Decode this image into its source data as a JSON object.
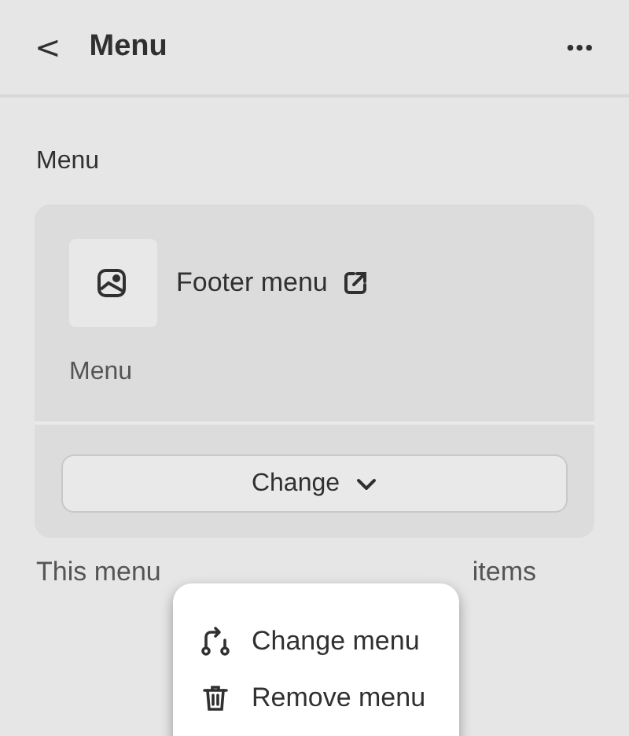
{
  "header": {
    "back": "<",
    "title": "Menu",
    "more": "•••"
  },
  "section": {
    "label": "Menu",
    "card": {
      "name": "Footer menu",
      "subtitle": "Menu",
      "button": "Change"
    },
    "note_parts": [
      "This menu",
      "items"
    ]
  },
  "popup": {
    "items": [
      {
        "kind": "change",
        "label": "Change menu"
      },
      {
        "kind": "remove",
        "label": "Remove menu"
      }
    ]
  }
}
